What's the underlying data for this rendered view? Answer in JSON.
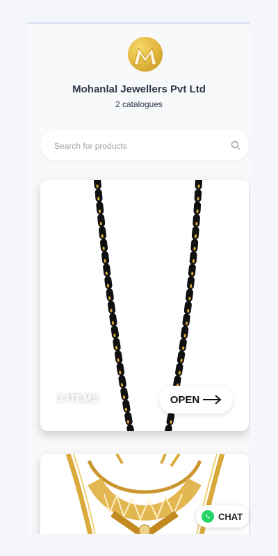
{
  "header": {
    "logo_icon": "mohanlal-logo-icon",
    "company_name": "Mohanlal Jewellers Pvt Ltd",
    "catalog_count": "2 catalogues"
  },
  "search": {
    "placeholder": "Search for products",
    "icon": "search-icon"
  },
  "catalogs": [
    {
      "items_label": "3 ITEMS",
      "open_label": "OPEN",
      "image": "black-bead-necklace"
    },
    {
      "image": "gold-necklace"
    }
  ],
  "chat": {
    "label": "CHAT",
    "icon": "whatsapp-icon"
  },
  "colors": {
    "accent_gold": "#e0b43a",
    "text_dark": "#2e3748",
    "whatsapp": "#25d366"
  }
}
